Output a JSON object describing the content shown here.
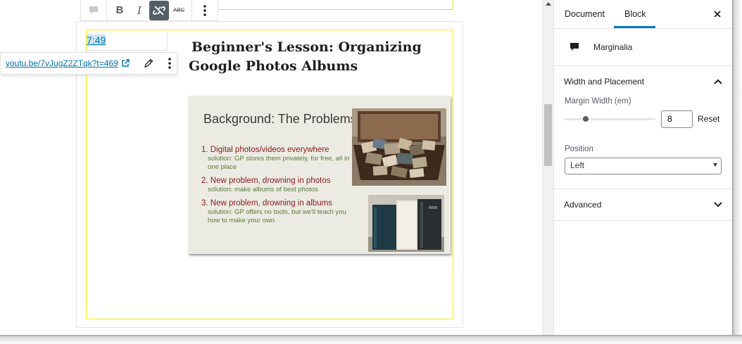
{
  "toolbar": {
    "bold_label": "B",
    "italic_label": "I",
    "strikethrough_label": "ABC"
  },
  "margin_note": {
    "link_text": "7:49"
  },
  "link_popover": {
    "url": "youtu.be/7vJugZ2ZTqk?t=469"
  },
  "content": {
    "title": "Beginner's Lesson: Organizing Google Photos Albums"
  },
  "slide": {
    "title": "Background: The Problems",
    "items": [
      {
        "main": "1. Digital photos/videos everywhere",
        "solution": "solution: GP stores them privately, for free, all in one place"
      },
      {
        "main": "2. New problem, drowning in photos",
        "solution": "solution: make albums of best photos"
      },
      {
        "main": "3. New problem, drowning in albums",
        "solution": "solution: GP offers no tools, but we'll teach you how to make your own"
      }
    ]
  },
  "sidebar": {
    "tabs": [
      "Document",
      "Block"
    ],
    "active_tab": "Block",
    "block_name": "Marginalia",
    "panels": {
      "width_placement": {
        "title": "Width and Placement",
        "margin_width_label": "Margin Width (em)",
        "margin_width_value": "8",
        "reset_label": "Reset",
        "position_label": "Position",
        "position_value": "Left"
      },
      "advanced": {
        "title": "Advanced"
      }
    }
  },
  "icons": {
    "block_type": "comment-icon",
    "unlink": "unlink-icon",
    "external": "external-link-icon",
    "edit": "pencil-icon",
    "more": "more-vertical-icon",
    "close": "close-icon",
    "collapse": "chevron-up-icon",
    "expand": "chevron-down-icon"
  },
  "colors": {
    "accent": "#007cba",
    "link": "#0073aa",
    "block_highlight": "#f2f200",
    "slide_heading_red": "#8b1a1a",
    "slide_solution_green": "#5a7a3a"
  }
}
